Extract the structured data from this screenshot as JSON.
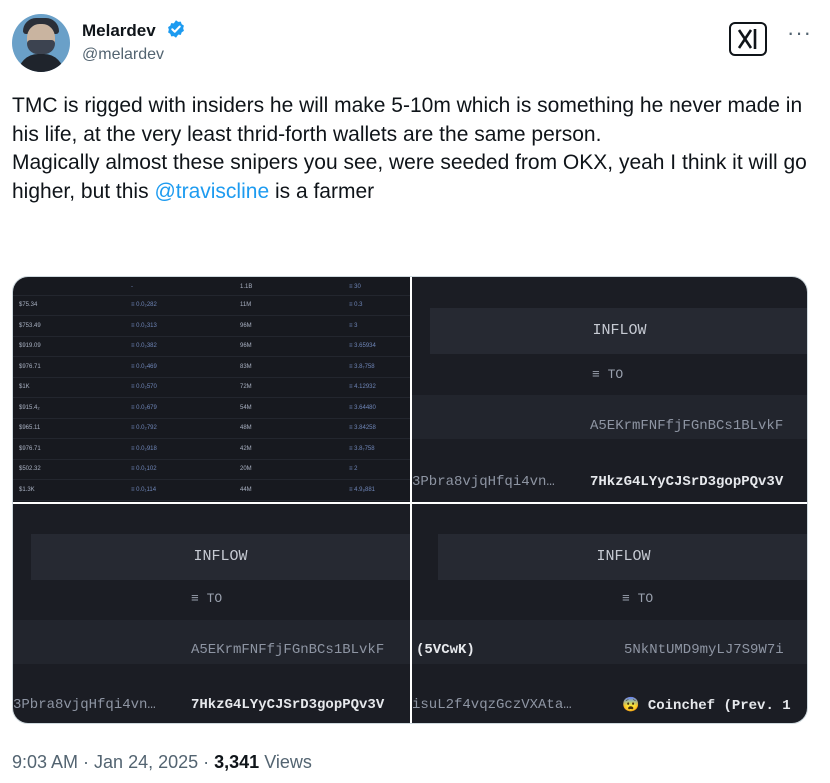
{
  "author": {
    "name": "Melardev",
    "handle": "@melardev"
  },
  "actions": {
    "more_label": "···"
  },
  "tweet": {
    "paragraph1": "TMC is rigged with insiders he will make 5-10m which is something he never made in his life, at the very least thrid-forth wallets are the same person.",
    "paragraph2_before": "Magically almost these snipers you see, were seeded from OKX, yeah I think it will go higher, but this ",
    "mention": "@traviscline",
    "paragraph2_after": " is a farmer"
  },
  "media": {
    "table": {
      "header": [
        "",
        "-",
        "1.1B",
        "≡ 30"
      ],
      "rows": [
        [
          "$75.34",
          "≡ 0.0₂282",
          "11M",
          "≡ 0.3"
        ],
        [
          "$753.49",
          "≡ 0.0₂313",
          "96M",
          "≡ 3"
        ],
        [
          "$919.09",
          "≡ 0.0₂382",
          "96M",
          "≡ 3.65934"
        ],
        [
          "$976.71",
          "≡ 0.0₂469",
          "83M",
          "≡ 3.8₇758"
        ],
        [
          "$1K",
          "≡ 0.0₂570",
          "72M",
          "≡ 4.12932"
        ],
        [
          "$915.4₂",
          "≡ 0.0₂679",
          "54M",
          "≡ 3.64480"
        ],
        [
          "$965.11",
          "≡ 0.0₂792",
          "48M",
          "≡ 3.84258"
        ],
        [
          "$976.71",
          "≡ 0.0₂918",
          "42M",
          "≡ 3.8₇758"
        ],
        [
          "$502.32",
          "≡ 0.0₁102",
          "20M",
          "≡ 2"
        ],
        [
          "$1.3K",
          "≡ 0.0₁114",
          "44M",
          "≡ 4.9₈881"
        ]
      ]
    },
    "panel2": {
      "inflow": "INFLOW",
      "to": "≡ TO",
      "addr_top": "A5EKrmFNFfjFGnBCs1BLvkF",
      "addr_left": "3Pbra8vjqHfqi4vn…",
      "addr_right": "7HkzG4LYyCJSrD3gopPQv3V"
    },
    "panel3": {
      "inflow": "INFLOW",
      "to": "≡ TO",
      "addr_top": "A5EKrmFNFfjFGnBCs1BLvkF",
      "addr_left": "3Pbra8vjqHfqi4vn…",
      "addr_right": "7HkzG4LYyCJSrD3gopPQv3V"
    },
    "panel4": {
      "inflow": "INFLOW",
      "to": "≡ TO",
      "addr_top_left": "(5VCwK)",
      "addr_top_right": "5NkNtUMD9myLJ7S9W7i",
      "addr_left": "isuL2f4vqzGczVXAta…",
      "addr_right": "😨 Coinchef (Prev. 1"
    }
  },
  "footer": {
    "time": "9:03 AM",
    "sep1": " · ",
    "date": "Jan 24, 2025",
    "sep2": " · ",
    "views_count": "3,341",
    "views_label": " Views"
  },
  "colors": {
    "mention": "#1d9bf0",
    "verified": "#1d9bf0",
    "text": "#0f1419",
    "muted": "#536471"
  },
  "icons": [
    "verified-badge-icon",
    "grok-icon",
    "more-icon"
  ]
}
